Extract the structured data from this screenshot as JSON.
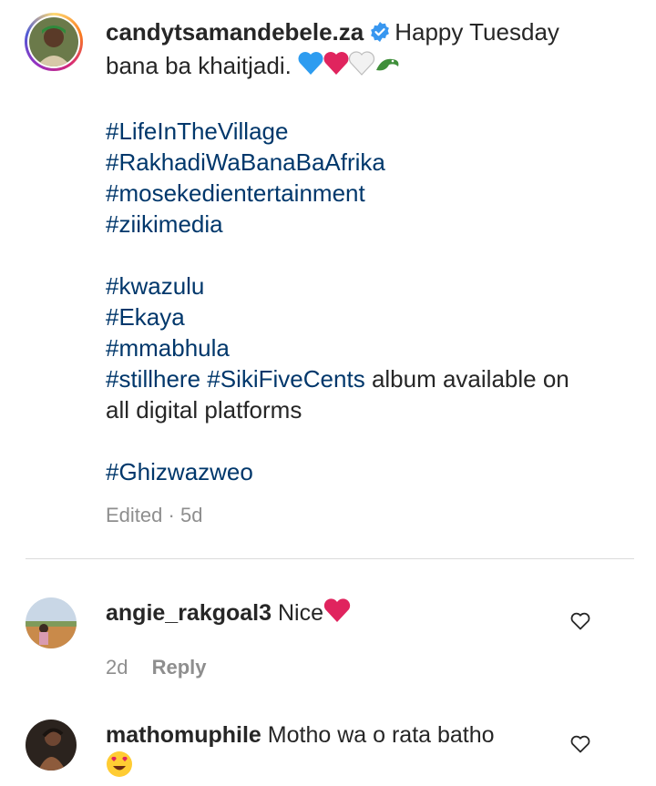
{
  "caption": {
    "username": "candytsamandebele.za",
    "text_line1": "Happy Tuesday",
    "text_line2": "bana ba khaitjadi.",
    "hashtags_group1": [
      "#LifeInTheVillage",
      "#RakhadiWaBanaBaAfrika",
      "#mosekedientertainment",
      "#ziikimedia"
    ],
    "hashtags_group2": [
      "#kwazulu",
      "#Ekaya",
      "#mmabhula"
    ],
    "line_stillhere_tag1": "#stillhere",
    "line_stillhere_tag2": "#SikiFiveCents",
    "line_stillhere_text": "album available on",
    "line_stillhere_cont": "all digital platforms",
    "last_tag": "#Ghizwazweo",
    "edited": "Edited",
    "dot": "·",
    "age": "5d"
  },
  "comments": [
    {
      "username": "angie_rakgoal3",
      "text": "Nice",
      "age": "2d",
      "reply_label": "Reply"
    },
    {
      "username": "mathomuphile",
      "text": "Motho wa o rata batho"
    }
  ],
  "icons": {
    "verified": "verified-badge-icon",
    "like": "heart-outline-icon"
  },
  "colors": {
    "hashtag": "#00376b",
    "muted": "#8e8e8e",
    "verified": "#3897f0",
    "red_heart": "#e0245e",
    "blue_heart": "#2d9cf0"
  }
}
